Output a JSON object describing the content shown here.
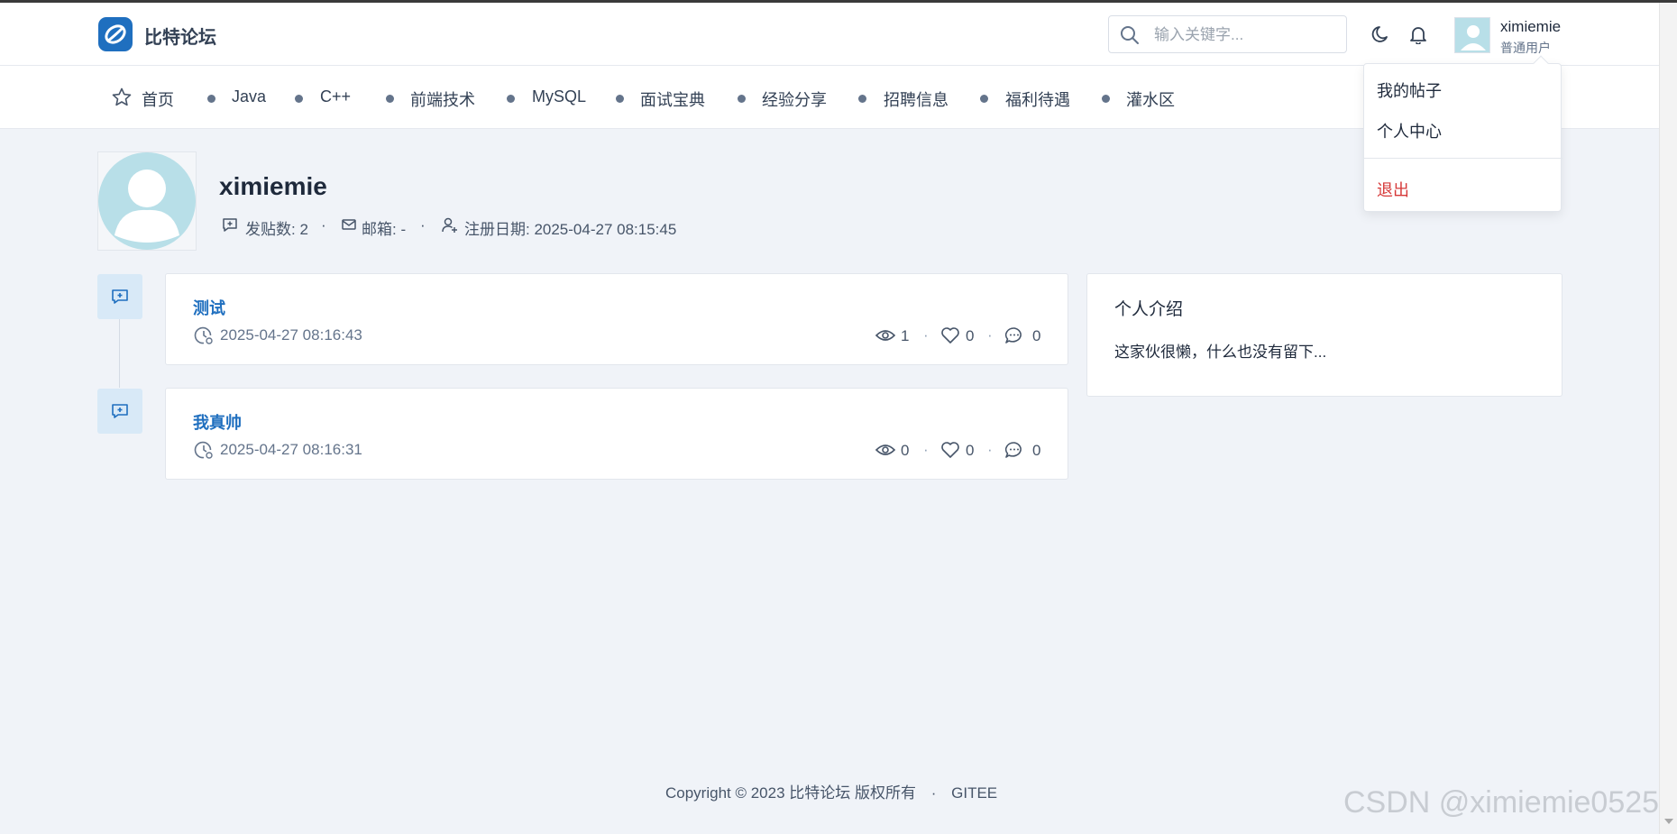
{
  "header": {
    "brand": "比特论坛",
    "search_placeholder": "输入关键字...",
    "user": {
      "name": "ximiemie",
      "role": "普通用户"
    }
  },
  "nav": {
    "items": [
      "首页",
      "Java",
      "C++",
      "前端技术",
      "MySQL",
      "面试宝典",
      "经验分享",
      "招聘信息",
      "福利待遇",
      "灌水区"
    ]
  },
  "dropdown": {
    "items": [
      "我的帖子",
      "个人中心"
    ],
    "logout": "退出"
  },
  "profile": {
    "name": "ximiemie",
    "posts": "发贴数: 2",
    "email": "邮箱: -",
    "register": "注册日期: 2025-04-27 08:15:45",
    "sep": "·"
  },
  "posts": [
    {
      "title": "测试",
      "date": "2025-04-27 08:16:43",
      "views": "1",
      "likes": "0",
      "comments": "0"
    },
    {
      "title": "我真帅",
      "date": "2025-04-27 08:16:31",
      "views": "0",
      "likes": "0",
      "comments": "0"
    }
  ],
  "intro": {
    "title": "个人介绍",
    "text": "这家伙很懒，什么也没有留下..."
  },
  "footer": {
    "copyright": "Copyright © 2023 比特论坛 版权所有",
    "sep": "·",
    "link": "GITEE"
  },
  "watermark": "CSDN @ximiemie0525",
  "colors": {
    "accent": "#1f6fbf",
    "danger": "#d63939",
    "background": "#f0f3f8"
  }
}
